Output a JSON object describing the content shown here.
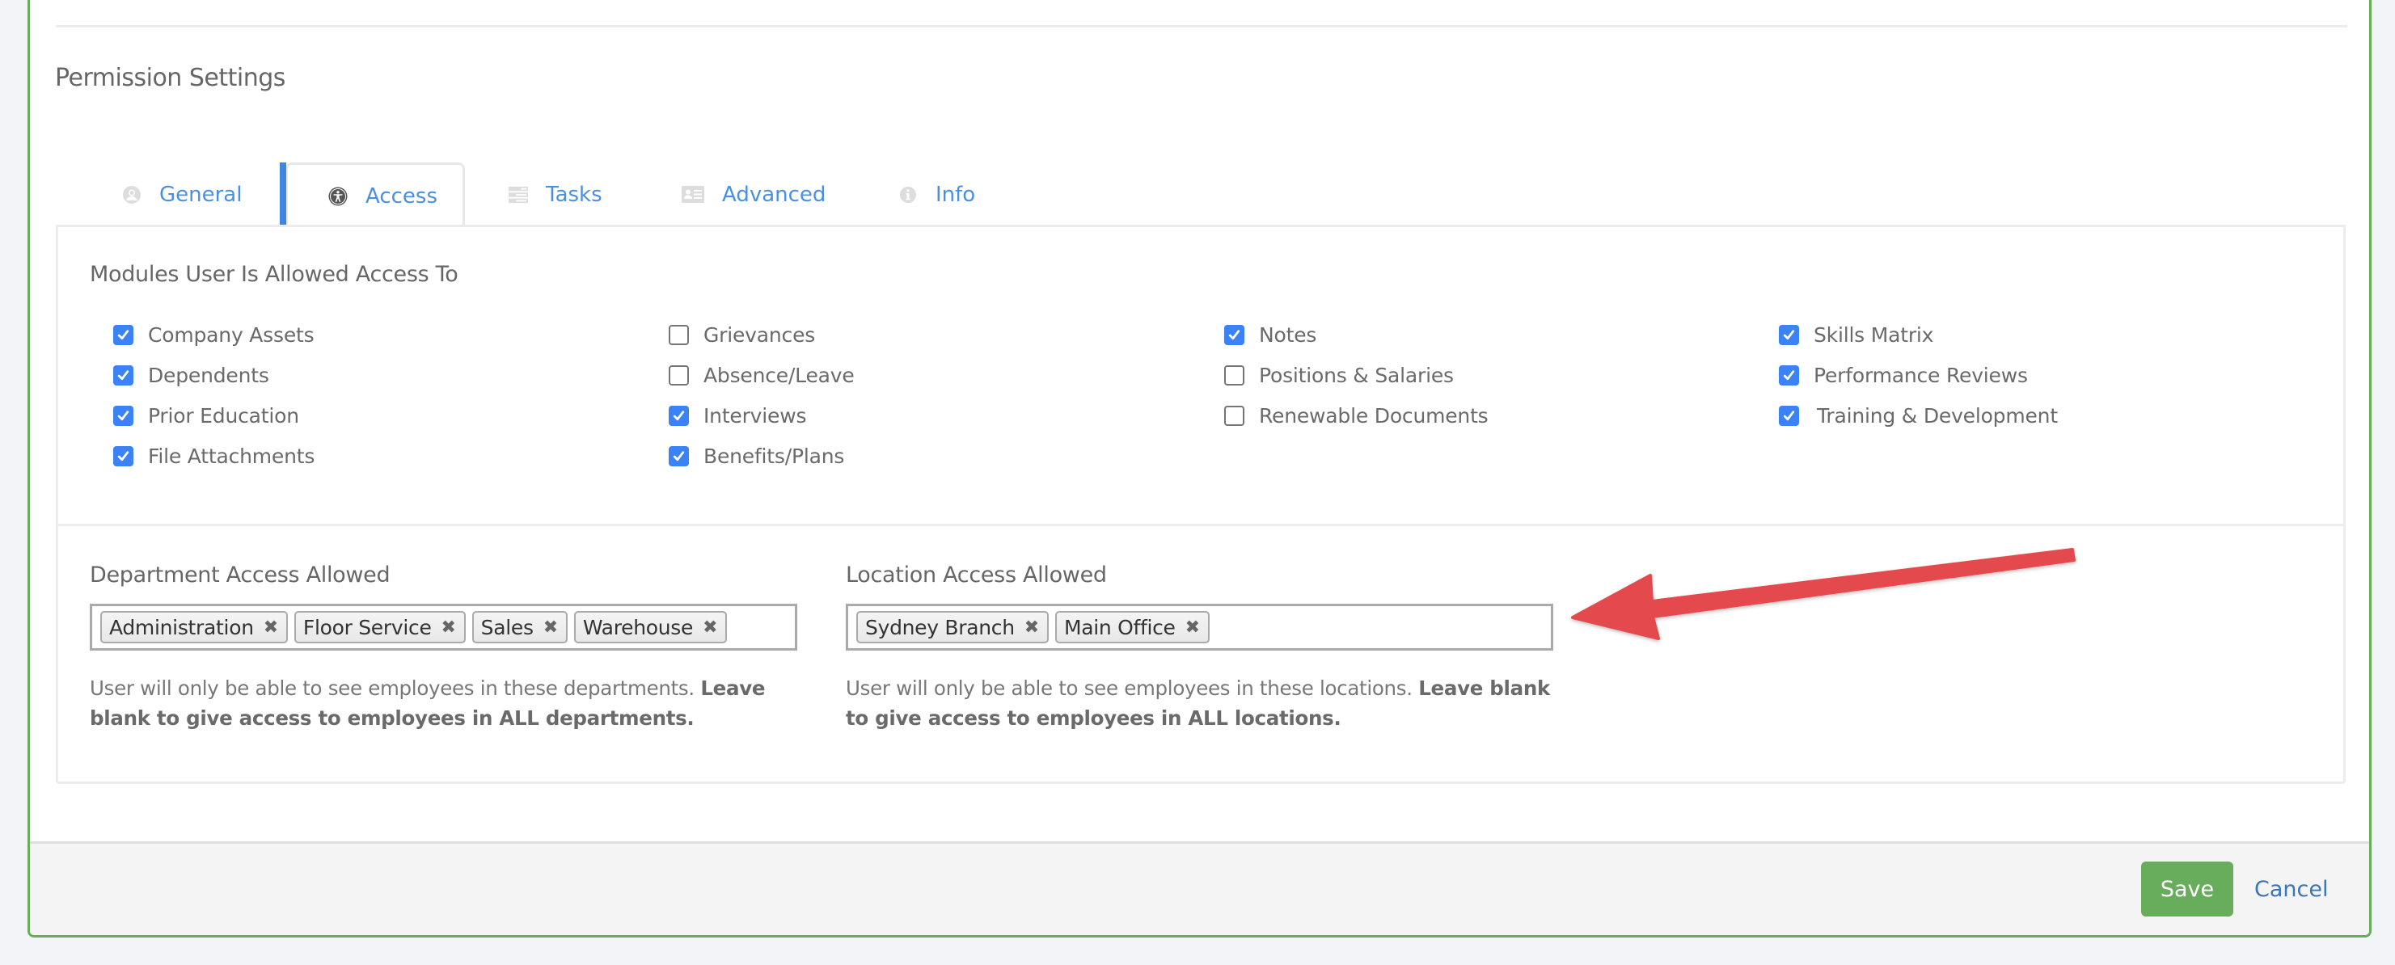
{
  "section": {
    "title": "Permission Settings"
  },
  "tabs": [
    {
      "label": "General",
      "icon": "user-circle-icon",
      "active": false
    },
    {
      "label": "Access",
      "icon": "accessibility-icon",
      "active": true
    },
    {
      "label": "Tasks",
      "icon": "tasks-list-icon",
      "active": false
    },
    {
      "label": "Advanced",
      "icon": "id-card-icon",
      "active": false
    },
    {
      "label": "Info",
      "icon": "info-circle-icon",
      "active": false
    }
  ],
  "modules": {
    "title": "Modules User Is Allowed Access To",
    "columns": [
      [
        {
          "label": "Company Assets",
          "checked": true
        },
        {
          "label": "Dependents",
          "checked": true
        },
        {
          "label": "Prior Education",
          "checked": true
        },
        {
          "label": "File Attachments",
          "checked": true
        }
      ],
      [
        {
          "label": "Grievances",
          "checked": false
        },
        {
          "label": "Absence/Leave",
          "checked": false
        },
        {
          "label": "Interviews",
          "checked": true
        },
        {
          "label": "Benefits/Plans",
          "checked": true
        }
      ],
      [
        {
          "label": "Notes",
          "checked": true
        },
        {
          "label": "Positions & Salaries",
          "checked": false
        },
        {
          "label": "Renewable Documents",
          "checked": false
        }
      ],
      [
        {
          "label": "Skills Matrix",
          "checked": true
        },
        {
          "label": "Performance Reviews",
          "checked": true
        },
        {
          "label": "Training & Development",
          "checked": true
        }
      ]
    ]
  },
  "department_access": {
    "label": "Department Access Allowed",
    "tags": [
      "Administration",
      "Floor Service",
      "Sales",
      "Warehouse"
    ],
    "help_text": "User will only be able to see employees in these departments. ",
    "help_bold": "Leave blank to give access to employees in ALL departments."
  },
  "location_access": {
    "label": "Location Access Allowed",
    "tags": [
      "Sydney Branch",
      "Main Office"
    ],
    "help_text": "User will only be able to see employees in these locations. ",
    "help_bold": "Leave blank to give access to employees in ALL locations."
  },
  "footer": {
    "save_label": "Save",
    "cancel_label": "Cancel"
  },
  "tag_remove_glyph": "✖",
  "colors": {
    "accent": "#3f86e0",
    "link": "#4a90e2",
    "save": "#67ad5b",
    "checkbox": "#3b82f6",
    "annotation_arrow": "#e34a4e"
  }
}
